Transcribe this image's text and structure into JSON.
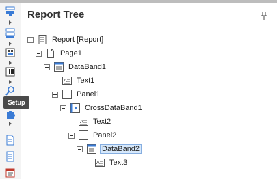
{
  "toolbar": {
    "tooltip": "Setup"
  },
  "panel": {
    "title": "Report Tree"
  },
  "tree": [
    {
      "label": "Report [Report]",
      "icon": "report-icon"
    },
    {
      "label": "Page1",
      "icon": "page-icon"
    },
    {
      "label": "DataBand1",
      "icon": "databand-icon"
    },
    {
      "label": "Text1",
      "icon": "text-component-icon"
    },
    {
      "label": "Panel1",
      "icon": "panel-icon"
    },
    {
      "label": "CrossDataBand1",
      "icon": "crossdataband-icon"
    },
    {
      "label": "Text2",
      "icon": "text-component-icon"
    },
    {
      "label": "Panel2",
      "icon": "panel-icon"
    },
    {
      "label": "DataBand2",
      "icon": "databand-icon",
      "selected": true
    },
    {
      "label": "Text3",
      "icon": "text-component-icon"
    }
  ],
  "colors": {
    "selection": "#d6e8fb",
    "toolbar_icon_blue": "#3a7bd5",
    "tooltip_bg": "#4a4a4a"
  }
}
